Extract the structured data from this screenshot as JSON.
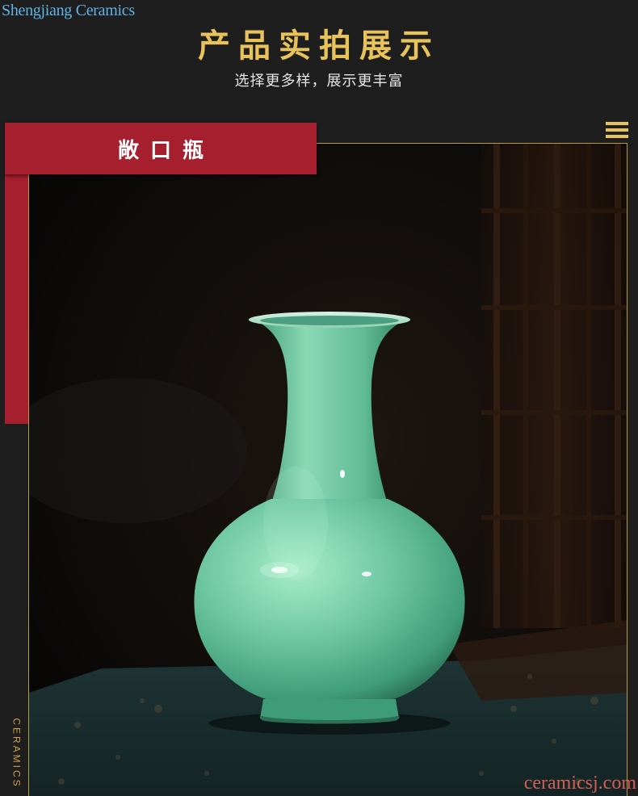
{
  "brand": "Shengjiang Ceramics",
  "header": {
    "title": "产品实拍展示",
    "subtitle": "选择更多样，展示更丰富"
  },
  "label": {
    "text": "敞口瓶"
  },
  "side_text": "CERAMICS",
  "watermark": "ceramicsj.com",
  "photo": {
    "subject": "celadon-vase",
    "colors": {
      "accent_gold": "#e8c25a",
      "label_red": "#a51f2e",
      "vase_green": "#6fc8a3"
    }
  }
}
